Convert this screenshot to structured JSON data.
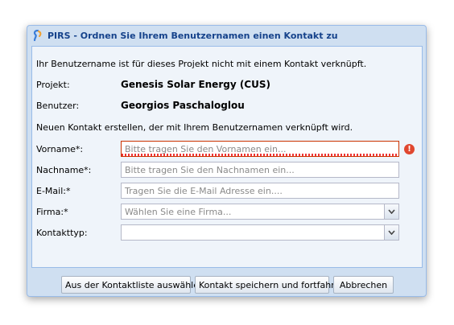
{
  "window": {
    "title": "PIRS - Ordnen Sie Ihrem Benutzernamen einen Kontakt zu"
  },
  "intro": "Ihr Benutzername ist für dieses Projekt nicht mit einem Kontakt verknüpft.",
  "project": {
    "label": "Projekt:",
    "value": "Genesis Solar Energy (CUS)"
  },
  "user": {
    "label": "Benutzer:",
    "value": "Georgios Paschaloglou"
  },
  "new_contact_text": "Neuen Kontakt erstellen, der mit Ihrem Benutzernamen verknüpft wird.",
  "form": {
    "firstname": {
      "label": "Vorname*:",
      "placeholder": "Bitte tragen Sie den Vornamen ein..."
    },
    "lastname": {
      "label": "Nachname*:",
      "placeholder": "Bitte tragen Sie den Nachnamen ein..."
    },
    "email": {
      "label": "E-Mail:*",
      "placeholder": "Tragen Sie die E-Mail Adresse ein...."
    },
    "company": {
      "label": "Firma:*",
      "placeholder": "Wählen Sie eine Firma..."
    },
    "contact_type": {
      "label": "Kontakttyp:",
      "value": ""
    }
  },
  "buttons": {
    "select_from_list": "Aus der Kontaktliste auswählen",
    "save_continue": "Kontakt speichern und fortfahren",
    "cancel": "Abbrechen"
  },
  "colors": {
    "title_text": "#15428b",
    "window_frame": "#cfdff1",
    "panel_bg": "#eff4fa",
    "error": "#e0472f"
  }
}
